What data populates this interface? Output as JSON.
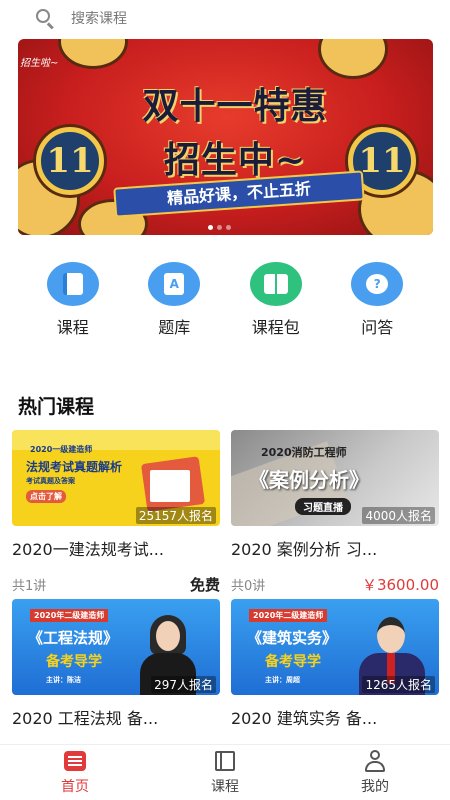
{
  "search": {
    "placeholder": "搜索课程"
  },
  "banner": {
    "line1": "双十一特惠",
    "line2": "招生中~",
    "slogan": "精品好课，不止五折",
    "medal_left": "11",
    "medal_right": "11",
    "tag": "招生啦~"
  },
  "quick_nav": [
    {
      "label": "课程",
      "icon": "book-icon",
      "color": "#4a9ef0"
    },
    {
      "label": "题库",
      "icon": "question-bank-icon",
      "color": "#4a9ef0"
    },
    {
      "label": "课程包",
      "icon": "course-package-icon",
      "color": "#2ec27e"
    },
    {
      "label": "问答",
      "icon": "qa-icon",
      "color": "#4a9ef0"
    }
  ],
  "section": {
    "title": "热门课程"
  },
  "courses": [
    {
      "title": "2020一建法规考试...",
      "enrolled": "25157人报名",
      "lessons": "共1讲",
      "price": "免费",
      "thumb_lines": [
        "2020一级建造师",
        "法规考试真题解析",
        "考试真题及答案",
        "点击了解"
      ]
    },
    {
      "title": "2020 案例分析 习...",
      "enrolled": "4000人报名",
      "lessons": "共0讲",
      "price": "￥3600.00",
      "thumb_lines": [
        "2020消防工程师",
        "《案例分析》",
        "习题直播"
      ]
    },
    {
      "title": "2020 工程法规 备...",
      "enrolled": "297人报名",
      "lessons": "",
      "price": "免费",
      "thumb_lines": [
        "2020年二级建造师",
        "《工程法规》",
        "备考导学",
        "主讲：陈洁"
      ]
    },
    {
      "title": "2020 建筑实务 备...",
      "enrolled": "1265人报名",
      "lessons": "",
      "price": "免费",
      "thumb_lines": [
        "2020年二级建造师",
        "《建筑实务》",
        "备考导学",
        "主讲：周超"
      ]
    }
  ],
  "tabs": [
    {
      "label": "首页",
      "icon": "home-list-icon",
      "active": true
    },
    {
      "label": "课程",
      "icon": "course-book-icon",
      "active": false
    },
    {
      "label": "我的",
      "icon": "user-icon",
      "active": false
    }
  ],
  "colors": {
    "accent": "#e03a3a",
    "blue": "#4a9ef0",
    "green": "#2ec27e"
  }
}
